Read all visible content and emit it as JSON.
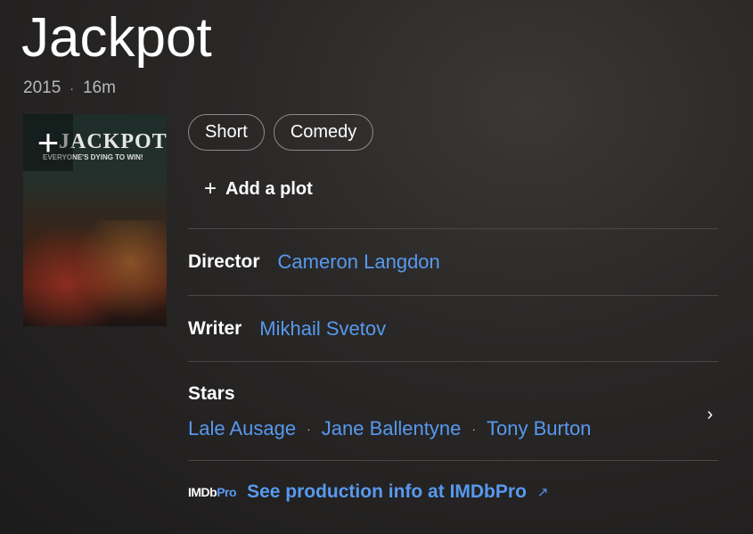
{
  "title": "Jackpot",
  "year": "2015",
  "runtime": "16m",
  "poster": {
    "title_text": "JACKPOT",
    "tagline": "EVERYONE'S DYING TO WIN!",
    "add_icon": "plus-icon"
  },
  "genres": [
    "Short",
    "Comedy"
  ],
  "add_plot": "Add a plot",
  "director": {
    "label": "Director",
    "name": "Cameron Langdon"
  },
  "writer": {
    "label": "Writer",
    "name": "Mikhail Svetov"
  },
  "stars": {
    "label": "Stars",
    "names": [
      "Lale Ausage",
      "Jane Ballentyne",
      "Tony Burton"
    ]
  },
  "imdbpro": {
    "logo_left": "IMDb",
    "logo_right": "Pro",
    "link": "See production info at IMDbPro"
  },
  "colors": {
    "link": "#5799ef",
    "background": "#1c1b1b"
  }
}
